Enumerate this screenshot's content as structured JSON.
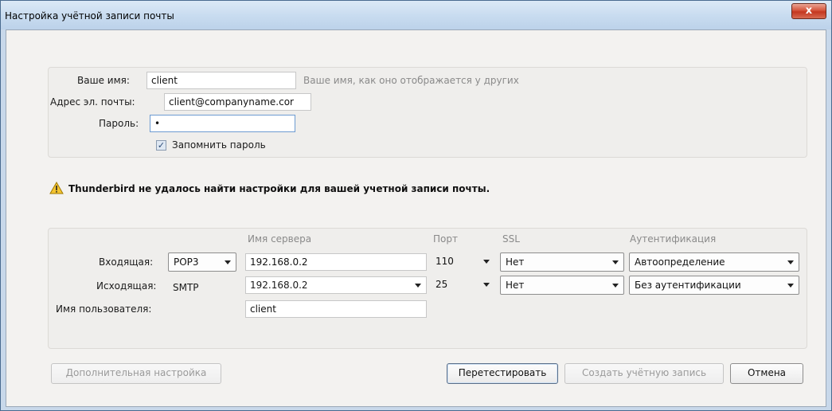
{
  "window": {
    "title": "Настройка учётной записи почты",
    "close_glyph": "x"
  },
  "identity": {
    "name_label": "Ваше имя:",
    "name_value": "client",
    "name_hint": "Ваше имя, как оно отображается у других",
    "email_label": "Адрес эл. почты:",
    "email_value": "client@companyname.cor",
    "password_label": "Пароль:",
    "password_value": "•",
    "remember_label": "Запомнить пароль",
    "remember_checked": true
  },
  "warning": {
    "icon": "warning-triangle-icon",
    "text": "Thunderbird не удалось найти настройки для вашей учетной записи почты."
  },
  "server": {
    "headers": {
      "server_name": "Имя сервера",
      "port": "Порт",
      "ssl": "SSL",
      "auth": "Аутентификация"
    },
    "incoming": {
      "label": "Входящая:",
      "protocol": "POP3",
      "server": "192.168.0.2",
      "port": "110",
      "ssl": "Нет",
      "auth": "Автоопределение"
    },
    "outgoing": {
      "label": "Исходящая:",
      "protocol": "SMTP",
      "server": "192.168.0.2",
      "port": "25",
      "ssl": "Нет",
      "auth": "Без аутентификации"
    },
    "username": {
      "label": "Имя пользователя:",
      "value": "client"
    }
  },
  "buttons": {
    "advanced": "Дополнительная настройка",
    "retest": "Перетестировать",
    "create": "Создать учётную запись",
    "cancel": "Отмена"
  }
}
